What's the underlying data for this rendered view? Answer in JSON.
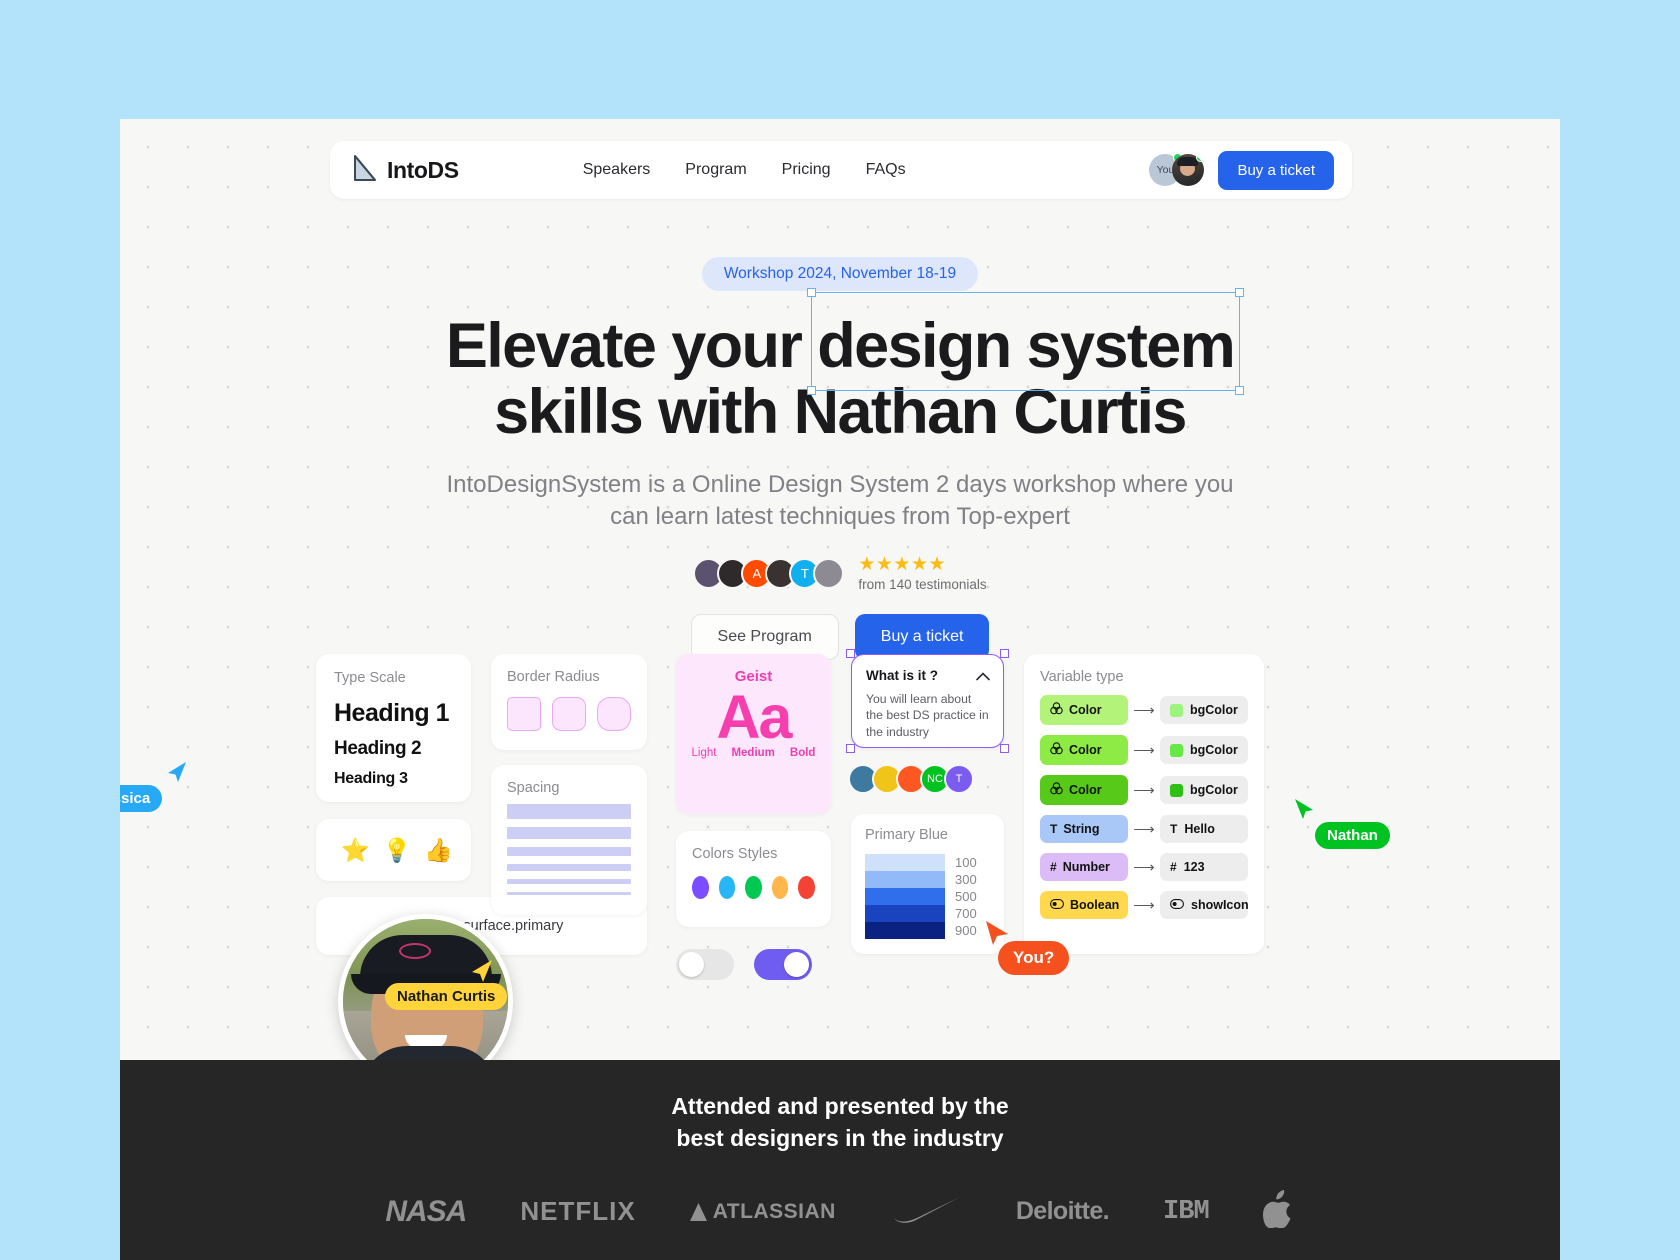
{
  "colors": {
    "page_bg": "#b3e2fb",
    "canvas_bg": "#f7f7f5",
    "brand_blue": "#2563eb",
    "footer_bg": "#262626",
    "cursor_jessica": "#27a9f5",
    "cursor_nathan": "#00c221",
    "cursor_nathan_curtis": "#ffd43b",
    "cursor_you": "#f4511e",
    "selection_blue": "#63b3ed",
    "selection_purple": "#8b5cf6"
  },
  "nav": {
    "brand": "IntoDS",
    "logo_icon": "triangle-ruler-icon",
    "links": [
      {
        "label": "Speakers"
      },
      {
        "label": "Program"
      },
      {
        "label": "Pricing"
      },
      {
        "label": "FAQs"
      }
    ],
    "avatar_you_label": "You",
    "cta_label": "Buy a ticket"
  },
  "hero": {
    "badge": "Workshop 2024, November 18-19",
    "headline_pre": "Elevate your ",
    "headline_selected": "design system",
    "headline_line2": "skills with Nathan Curtis",
    "subhead": "IntoDesignSystem is a Online Design System 2 days workshop where you can learn latest techniques from Top-expert",
    "stars": "★★★★★",
    "testimonials": "from 140 testimonials",
    "avatars": [
      {
        "type": "photo",
        "initial": "",
        "color": "#5b5270"
      },
      {
        "type": "photo",
        "initial": "",
        "color": "#2e2a2c"
      },
      {
        "type": "initial",
        "initial": "A",
        "color": "#ff4a00"
      },
      {
        "type": "photo",
        "initial": "",
        "color": "#3a3230"
      },
      {
        "type": "initial",
        "initial": "T",
        "color": "#10aff0"
      },
      {
        "type": "photo",
        "initial": "",
        "color": "#8d8a93"
      }
    ],
    "btn_secondary": "See Program",
    "btn_primary": "Buy a ticket"
  },
  "cards": {
    "type_scale": {
      "label": "Type Scale",
      "h1": "Heading 1",
      "h2": "Heading 2",
      "h3": "Heading 3"
    },
    "border_radius": {
      "label": "Border Radius"
    },
    "spacing": {
      "label": "Spacing"
    },
    "surface_token": {
      "text": "olor.surface.primary"
    },
    "geist": {
      "name": "Geist",
      "sample": "Aa",
      "weights": [
        "Light",
        "Medium",
        "Bold"
      ]
    },
    "colors_styles": {
      "label": "Colors Styles",
      "swatches": [
        "#7c4dff",
        "#29b6f6",
        "#00c853",
        "#ffb74d",
        "#f44336"
      ]
    },
    "faq": {
      "question": "What is it ?",
      "answer": "You will learn about the best DS practice in the industry",
      "chevron": "chevron-up-icon",
      "avatars": [
        {
          "type": "photo",
          "initial": "",
          "color": "#3e7aa0"
        },
        {
          "type": "photo",
          "initial": "",
          "color": "#f0c419"
        },
        {
          "type": "initial",
          "initial": "",
          "color": "#ff5722"
        },
        {
          "type": "initial",
          "initial": "NC",
          "color": "#00c221"
        },
        {
          "type": "initial",
          "initial": "T",
          "color": "#7c5cf0"
        }
      ]
    },
    "primary_blue": {
      "label": "Primary Blue",
      "shades": [
        {
          "num": "100",
          "hex": "#cfe0fb"
        },
        {
          "num": "300",
          "hex": "#93baf8"
        },
        {
          "num": "500",
          "hex": "#2f6fec"
        },
        {
          "num": "700",
          "hex": "#1a43c0"
        },
        {
          "num": "900",
          "hex": "#0a2383"
        }
      ]
    },
    "variable_type": {
      "label": "Variable type",
      "rows": [
        {
          "type": "Color",
          "icon": "color-icon",
          "chip_bg": "#b4f37a",
          "out_label": "bgColor",
          "out_swatch": "#9cf47d",
          "out_icon": "swatch"
        },
        {
          "type": "Color",
          "icon": "color-icon",
          "chip_bg": "#8eeb46",
          "out_label": "bgColor",
          "out_swatch": "#66e845",
          "out_icon": "swatch"
        },
        {
          "type": "Color",
          "icon": "color-icon",
          "chip_bg": "#56c919",
          "out_label": "bgColor",
          "out_swatch": "#2fc014",
          "out_icon": "swatch"
        },
        {
          "type": "String",
          "icon": "text-icon",
          "chip_bg": "#a9c7f7",
          "out_label": "Hello",
          "out_swatch": "",
          "out_icon": "T"
        },
        {
          "type": "Number",
          "icon": "hash-icon",
          "chip_bg": "#dcbcf7",
          "out_label": "123",
          "out_swatch": "",
          "out_icon": "#"
        },
        {
          "type": "Boolean",
          "icon": "toggle-icon",
          "chip_bg": "#ffd84d",
          "out_label": "showIcon",
          "out_swatch": "",
          "out_icon": "toggle"
        }
      ],
      "arrow": "arrow-right-icon"
    },
    "emoji": [
      "⭐",
      "💡",
      "👍"
    ]
  },
  "cursors": [
    {
      "name": "Jessica",
      "color": "#27a9f5"
    },
    {
      "name": "Nathan",
      "color": "#00c221"
    },
    {
      "name": "Nathan Curtis",
      "color": "#ffd43b"
    },
    {
      "name": "You?",
      "color": "#f4511e"
    }
  ],
  "footer": {
    "title_line1": "Attended and presented by the",
    "title_line2": "best designers in the industry",
    "logos": [
      {
        "name": "NASA",
        "kind": "nasa"
      },
      {
        "name": "NETFLIX",
        "kind": "netflix"
      },
      {
        "name": "ATLASSIAN",
        "kind": "atlassian"
      },
      {
        "name": "Nike",
        "kind": "nike"
      },
      {
        "name": "Deloitte.",
        "kind": "deloitte"
      },
      {
        "name": "IBM",
        "kind": "ibm"
      },
      {
        "name": "Apple",
        "kind": "apple"
      }
    ]
  }
}
